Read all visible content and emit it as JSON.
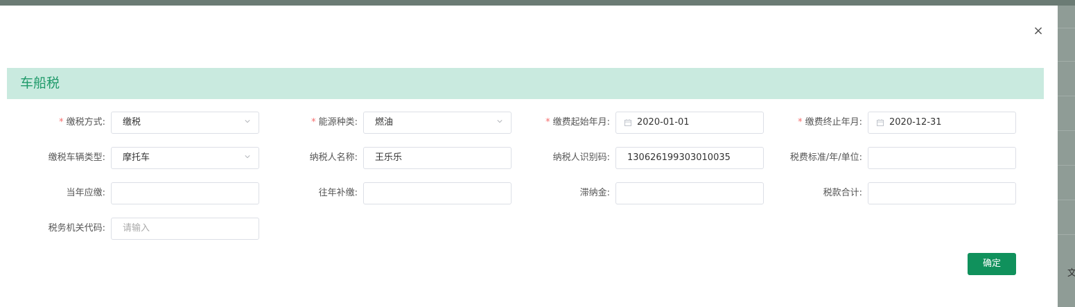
{
  "backdrop": {
    "peek_text": "文"
  },
  "dialog": {
    "close_symbol": "×",
    "section_title": "车船税",
    "confirm_label": "确定"
  },
  "form": {
    "row1": [
      {
        "label": "缴税方式:",
        "required": true,
        "type": "select",
        "value": "缴税"
      },
      {
        "label": "能源种类:",
        "required": true,
        "type": "select",
        "value": "燃油"
      },
      {
        "label": "缴费起始年月:",
        "required": true,
        "type": "date",
        "value": "2020-01-01"
      },
      {
        "label": "缴费终止年月:",
        "required": true,
        "type": "date",
        "value": "2020-12-31"
      }
    ],
    "row2": [
      {
        "label": "缴税车辆类型:",
        "required": false,
        "type": "select",
        "value": "摩托车"
      },
      {
        "label": "纳税人名称:",
        "required": false,
        "type": "text",
        "value": "王乐乐"
      },
      {
        "label": "纳税人识别码:",
        "required": false,
        "type": "text",
        "value": "130626199303010035"
      },
      {
        "label": "税费标准/年/单位:",
        "required": false,
        "type": "text",
        "value": ""
      }
    ],
    "row3": [
      {
        "label": "当年应缴:",
        "required": false,
        "type": "text",
        "value": ""
      },
      {
        "label": "往年补缴:",
        "required": false,
        "type": "text",
        "value": ""
      },
      {
        "label": "滞纳金:",
        "required": false,
        "type": "text",
        "value": ""
      },
      {
        "label": "税款合计:",
        "required": false,
        "type": "text",
        "value": ""
      }
    ],
    "row4": [
      {
        "label": "税务机关代码:",
        "required": false,
        "type": "text",
        "value": "",
        "placeholder": "请输入"
      }
    ]
  },
  "colors": {
    "accent": "#10915c",
    "section_bg": "#c9eadf",
    "required": "#f56c6c"
  }
}
